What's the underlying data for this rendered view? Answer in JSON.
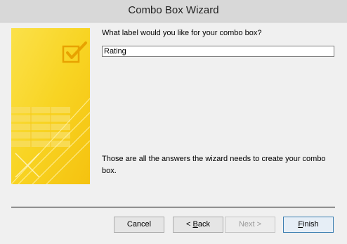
{
  "window": {
    "title": "Combo Box Wizard"
  },
  "prompt": {
    "question": "What label would you like for your combo box?"
  },
  "label_field": {
    "value": "Rating"
  },
  "info": {
    "text": "Those are all the answers the wizard needs to create your combo box."
  },
  "buttons": {
    "cancel": "Cancel",
    "back_key": "B",
    "back_rest": "ack",
    "back_prefix": "< ",
    "next": "Next >",
    "finish_key": "F",
    "finish_rest": "inish"
  },
  "colors": {
    "banner": "#f7d21a",
    "titlebar": "#d8d8d8",
    "client": "#f0f0f0"
  },
  "icons": {
    "banner": "checkbox-check-icon"
  }
}
